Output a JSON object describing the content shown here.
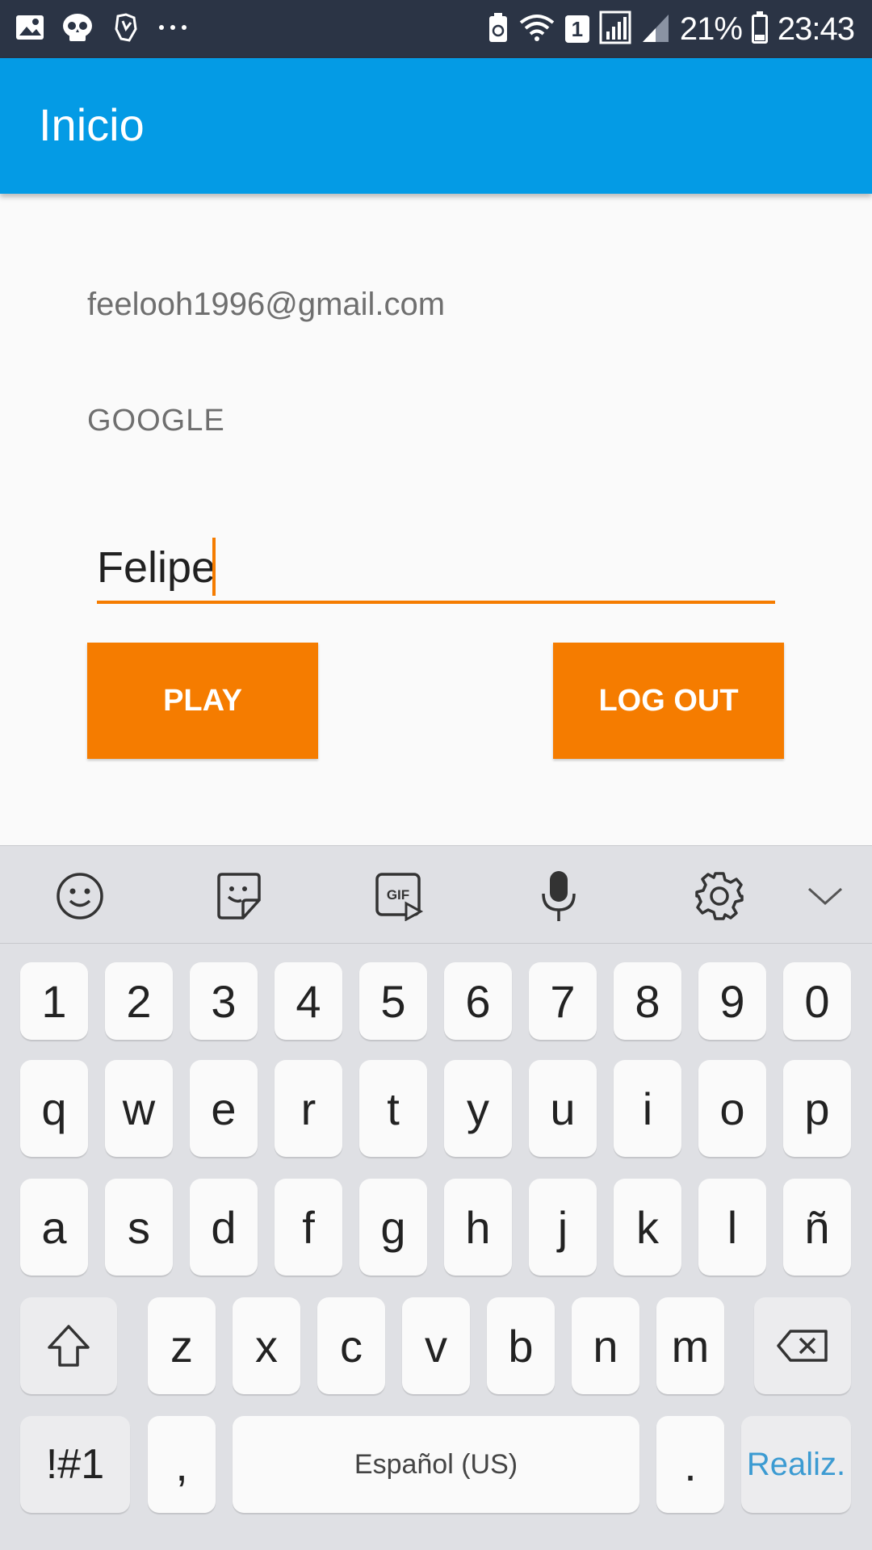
{
  "status_bar": {
    "battery_percent": "21%",
    "time": "23:43",
    "sim_badge": "1",
    "left_icons": [
      "image-icon",
      "skull-icon",
      "hand-icon",
      "more-icon"
    ],
    "right_icons": [
      "battery-saver-icon",
      "wifi-icon",
      "sim-icon",
      "signal-icon",
      "signal-icon-2",
      "battery-icon"
    ]
  },
  "app_bar": {
    "title": "Inicio"
  },
  "content": {
    "email": "feelooh1996@gmail.com",
    "provider": "GOOGLE",
    "name_value": "Felipe",
    "play_label": "PLAY",
    "logout_label": "LOG OUT"
  },
  "colors": {
    "status_bar": "#2b3445",
    "app_bar": "#049be5",
    "accent": "#f57c00",
    "keyboard_bg": "#dfe0e4"
  },
  "keyboard": {
    "toolbar_icons": [
      "emoji-icon",
      "sticker-icon",
      "gif-icon",
      "microphone-icon",
      "settings-icon",
      "collapse-icon"
    ],
    "gif_text": "GIF",
    "row_numbers": [
      "1",
      "2",
      "3",
      "4",
      "5",
      "6",
      "7",
      "8",
      "9",
      "0"
    ],
    "row_1": [
      "q",
      "w",
      "e",
      "r",
      "t",
      "y",
      "u",
      "i",
      "o",
      "p"
    ],
    "row_2": [
      "a",
      "s",
      "d",
      "f",
      "g",
      "h",
      "j",
      "k",
      "l",
      "ñ"
    ],
    "row_3": [
      "z",
      "x",
      "c",
      "v",
      "b",
      "n",
      "m"
    ],
    "symbols_label": "!#1",
    "comma_label": ",",
    "space_label": "Español (US)",
    "period_label": ".",
    "done_label": "Realiz."
  }
}
